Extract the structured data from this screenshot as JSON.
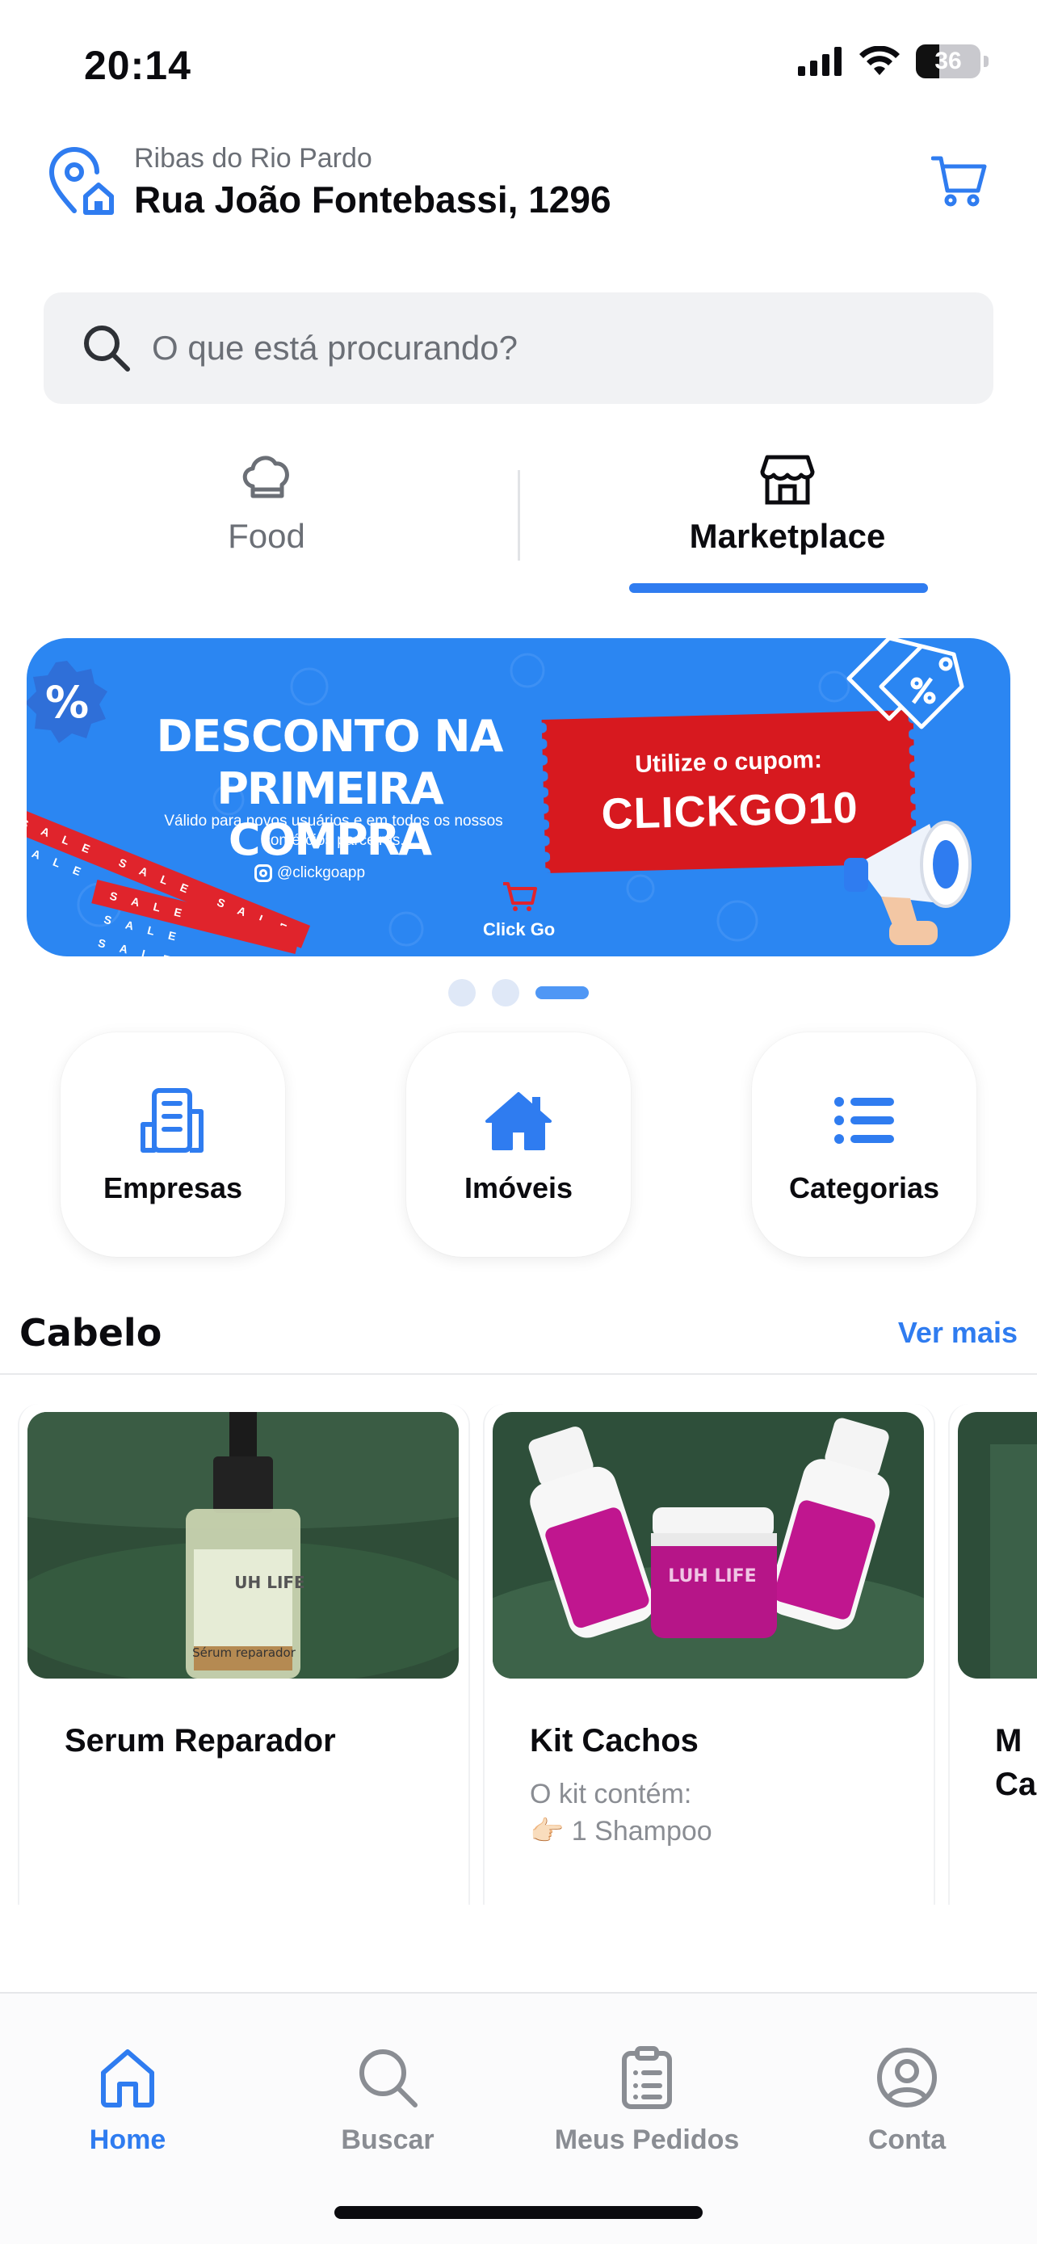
{
  "status_bar": {
    "time": "20:14",
    "battery_percent": "36",
    "icons": [
      "signal-icon",
      "wifi-icon",
      "battery-icon"
    ]
  },
  "header": {
    "city": "Ribas do Rio Pardo",
    "street": "Rua João Fontebassi, 1296",
    "location_icon": "location-home-icon",
    "cart_icon": "cart-icon"
  },
  "search": {
    "placeholder": "O que está procurando?",
    "value": ""
  },
  "mode_tabs": [
    {
      "label": "Food",
      "icon": "chef-hat-icon",
      "active": false
    },
    {
      "label": "Marketplace",
      "icon": "storefront-icon",
      "active": true
    }
  ],
  "banner": {
    "headline_line1": "DESCONTO NA",
    "headline_line2": "PRIMEIRA COMPRA",
    "subtext": "Válido para novos usuários e em todos os nossos comércios parceiros.",
    "instagram": "@clickgoapp",
    "brand": "Click Go",
    "coupon_label": "Utilize o cupom:",
    "coupon_code": "CLICKGO10",
    "ribbon_text": "SALE SALE SALE SALE",
    "slides_total": 3,
    "active_slide": 3
  },
  "shortcuts": [
    {
      "label": "Empresas",
      "icon": "building-icon"
    },
    {
      "label": "Imóveis",
      "icon": "house-icon"
    },
    {
      "label": "Categorias",
      "icon": "list-icon"
    }
  ],
  "section": {
    "title": "Cabelo",
    "link": "Ver mais"
  },
  "products": [
    {
      "name": "Serum Reparador",
      "desc_line1": "",
      "desc_line2": "",
      "img_text": "Sérum reparador"
    },
    {
      "name": "Kit Cachos",
      "desc_line1": "O kit contém:",
      "desc_line2": "👉🏻 1 Shampoo",
      "img_text": ""
    },
    {
      "name": "M\nCa",
      "desc_line1": "",
      "desc_line2": "",
      "img_text": ""
    }
  ],
  "bottom_nav": [
    {
      "label": "Home",
      "icon": "home-icon",
      "active": true
    },
    {
      "label": "Buscar",
      "icon": "search-icon",
      "active": false
    },
    {
      "label": "Meus Pedidos",
      "icon": "clipboard-icon",
      "active": false
    },
    {
      "label": "Conta",
      "icon": "user-circle-icon",
      "active": false
    }
  ],
  "colors": {
    "accent": "#2f7cf0",
    "banner_bg": "#2b86f2",
    "coupon_red": "#d7191f",
    "muted_text": "#6b6f76",
    "search_bg": "#f1f2f4"
  }
}
